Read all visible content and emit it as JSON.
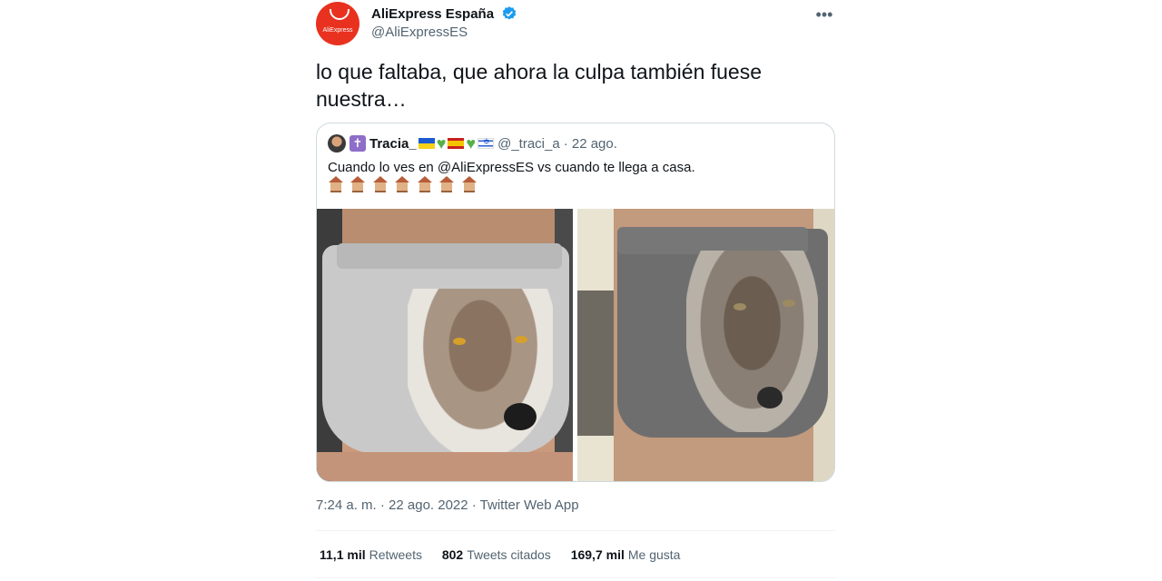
{
  "author": {
    "display_name": "AliExpress España",
    "handle": "@AliExpressES",
    "avatar_text": "AliExpress",
    "verified": true
  },
  "more_icon": "more-horizontal-icon",
  "tweet_text": "lo que faltaba, que ahora la culpa también fuese nuestra…",
  "quoted_tweet": {
    "display_name": "Tracia_",
    "handle": "@_traci_a",
    "date": "· 22 ago.",
    "text": "Cuando lo ves en @AliExpressES vs cuando te llega a casa.",
    "name_emojis": [
      "cross-icon",
      "ukraine-flag-icon",
      "green-heart-icon",
      "spain-flag-icon",
      "green-heart-icon",
      "israel-flag-icon"
    ],
    "emoji_row": [
      "house-icon",
      "house-icon",
      "house-icon",
      "house-icon",
      "house-icon",
      "house-icon",
      "house-icon"
    ],
    "images": [
      "wolf-boxers-product-photo",
      "wolf-boxers-received-photo"
    ]
  },
  "timestamp": "7:24 a. m. · 22 ago. 2022 · Twitter Web App",
  "stats": {
    "retweets_count": "11,1 mil",
    "retweets_label": "Retweets",
    "quotes_count": "802",
    "quotes_label": "Tweets citados",
    "likes_count": "169,7 mil",
    "likes_label": "Me gusta"
  },
  "colors": {
    "brand": "#e8321f",
    "verified": "#1d9bf0",
    "secondary_text": "#536471"
  }
}
